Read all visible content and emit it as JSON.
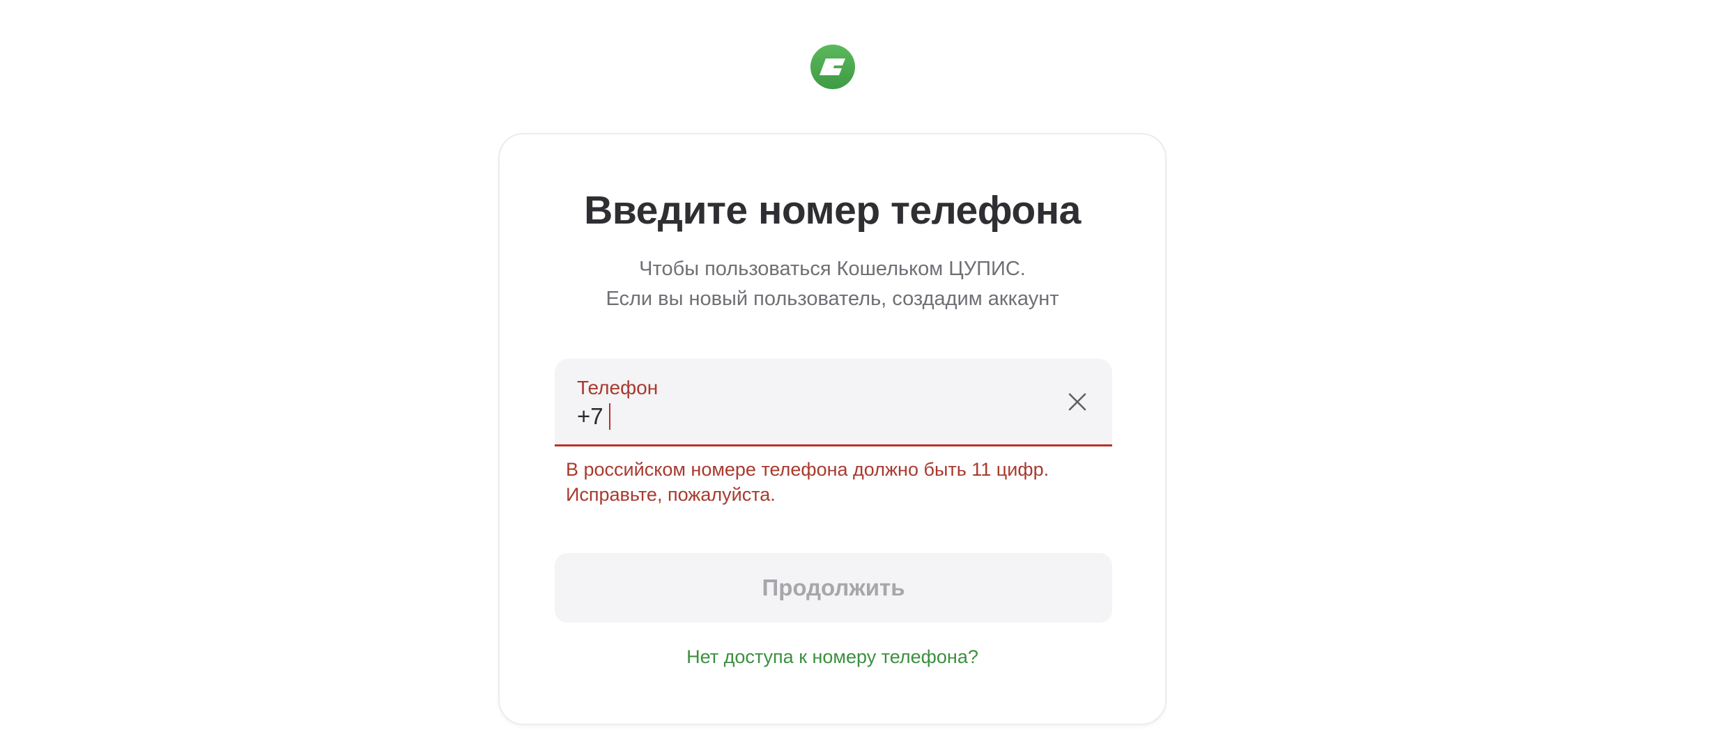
{
  "brand": {
    "logo_icon": "wallet-logo-icon",
    "accent_color": "#4caf50"
  },
  "form": {
    "title": "Введите номер телефона",
    "subtitle_line1": "Чтобы пользоваться Кошельком ЦУПИС.",
    "subtitle_line2": "Если вы новый пользователь, создадим аккаунт",
    "phone_label": "Телефон",
    "phone_value": "+7",
    "clear_icon": "close-icon",
    "error_line1": "В российском номере телефона должно быть 11 цифр.",
    "error_line2": "Исправьте, пожалуйста.",
    "error_color": "#a83a2e",
    "continue_label": "Продолжить",
    "help_link": "Нет доступа к номеру телефона?",
    "link_color": "#3c8f3e"
  }
}
